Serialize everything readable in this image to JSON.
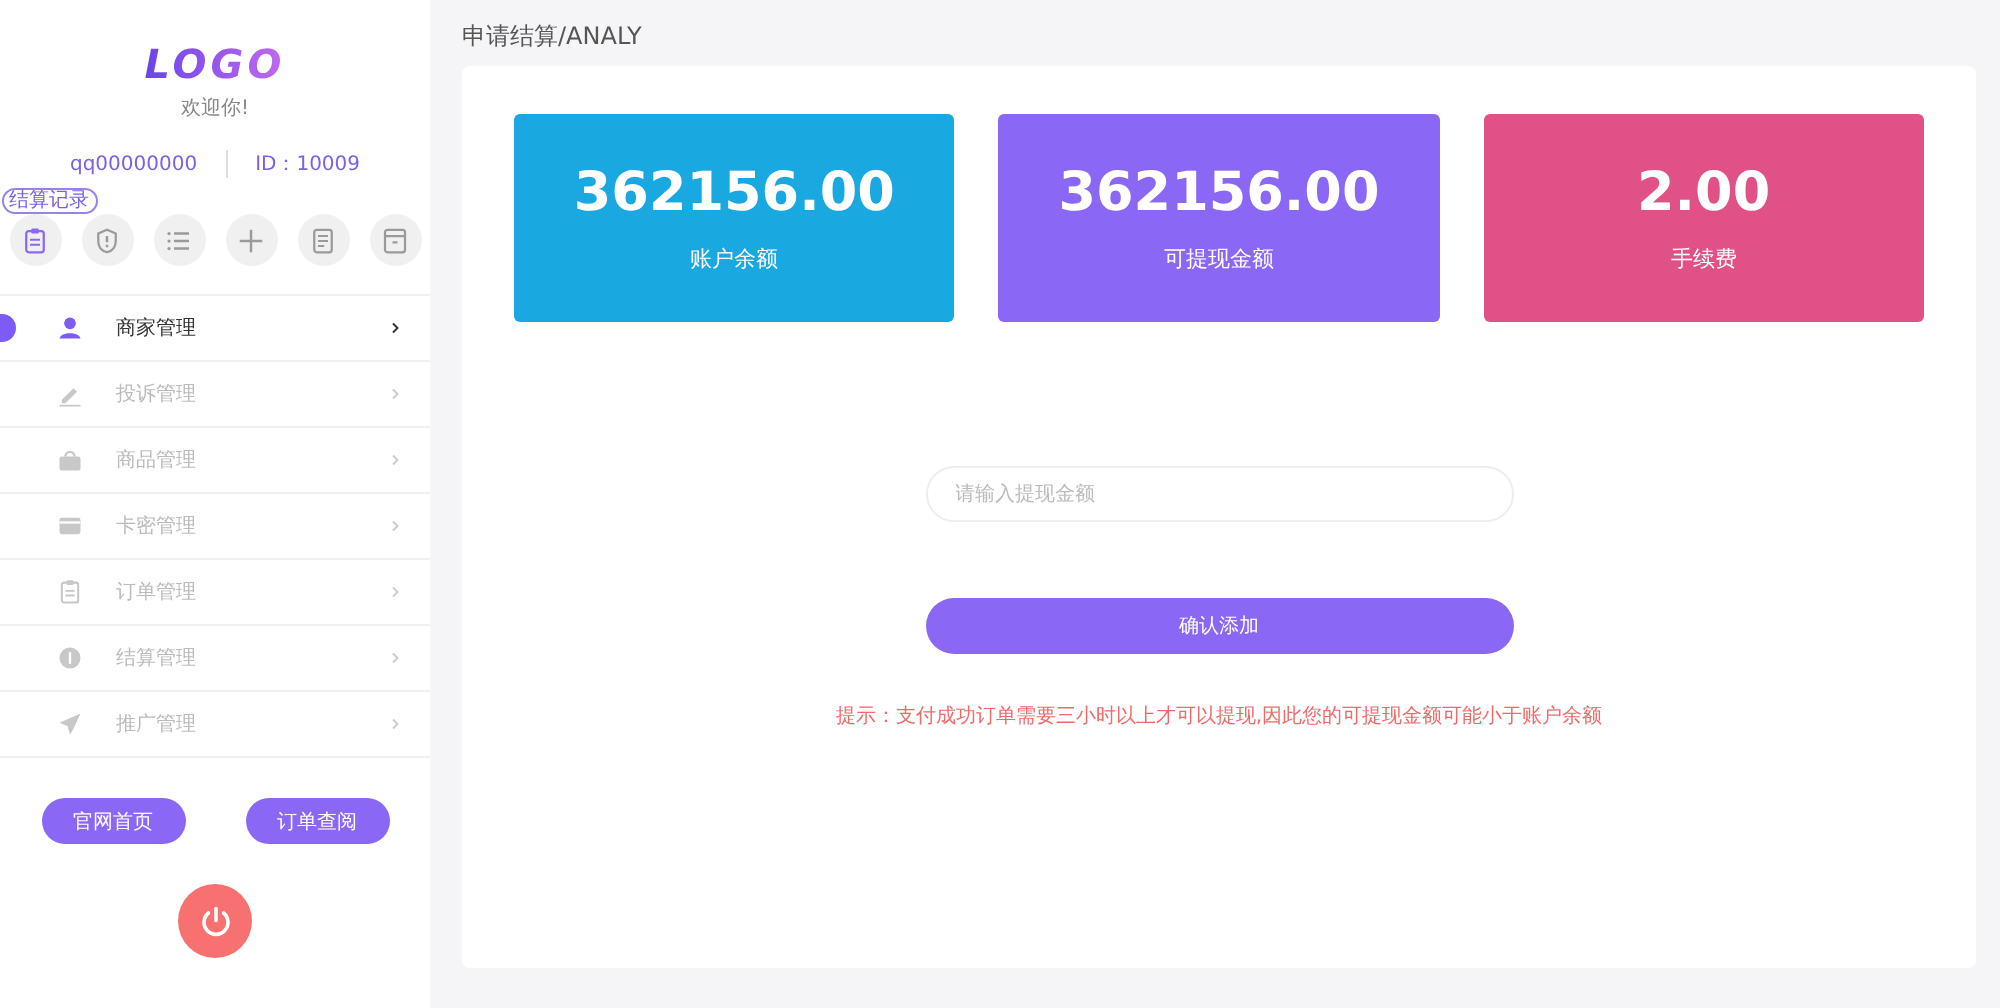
{
  "sidebar": {
    "logo": "LOGO",
    "welcome": "欢迎你!",
    "user": "qq00000000",
    "user_id": "ID：10009",
    "shortcuts": [
      {
        "kind": "clipboard",
        "selected": true,
        "tooltip": "结算记录"
      },
      {
        "kind": "shield",
        "selected": false
      },
      {
        "kind": "list",
        "selected": false
      },
      {
        "kind": "plus",
        "selected": false
      },
      {
        "kind": "document",
        "selected": false
      },
      {
        "kind": "archive",
        "selected": false
      }
    ],
    "menu": [
      {
        "kind": "user",
        "label": "商家管理",
        "selected": true
      },
      {
        "kind": "pencil",
        "label": "投诉管理",
        "selected": false
      },
      {
        "kind": "basket",
        "label": "商品管理",
        "selected": false
      },
      {
        "kind": "card",
        "label": "卡密管理",
        "selected": false
      },
      {
        "kind": "clipboard",
        "label": "订单管理",
        "selected": false
      },
      {
        "kind": "coin",
        "label": "结算管理",
        "selected": false
      },
      {
        "kind": "plane",
        "label": "推广管理",
        "selected": false
      }
    ],
    "buttons": [
      "官网首页",
      "订单查阅"
    ]
  },
  "breadcrumb": "申请结算/ANALY",
  "stats": [
    {
      "value": "362156.00",
      "label": "账户余额",
      "color": "#1aa8e0"
    },
    {
      "value": "362156.00",
      "label": "可提现金额",
      "color": "#8b67f5"
    },
    {
      "value": "2.00",
      "label": "手续费",
      "color": "#e05287"
    }
  ],
  "form": {
    "placeholder": "请输入提现金额",
    "submit": "确认添加",
    "hint": "提示：支付成功订单需要三小时以上才可以提现,因此您的可提现金额可能小于账户余额"
  }
}
